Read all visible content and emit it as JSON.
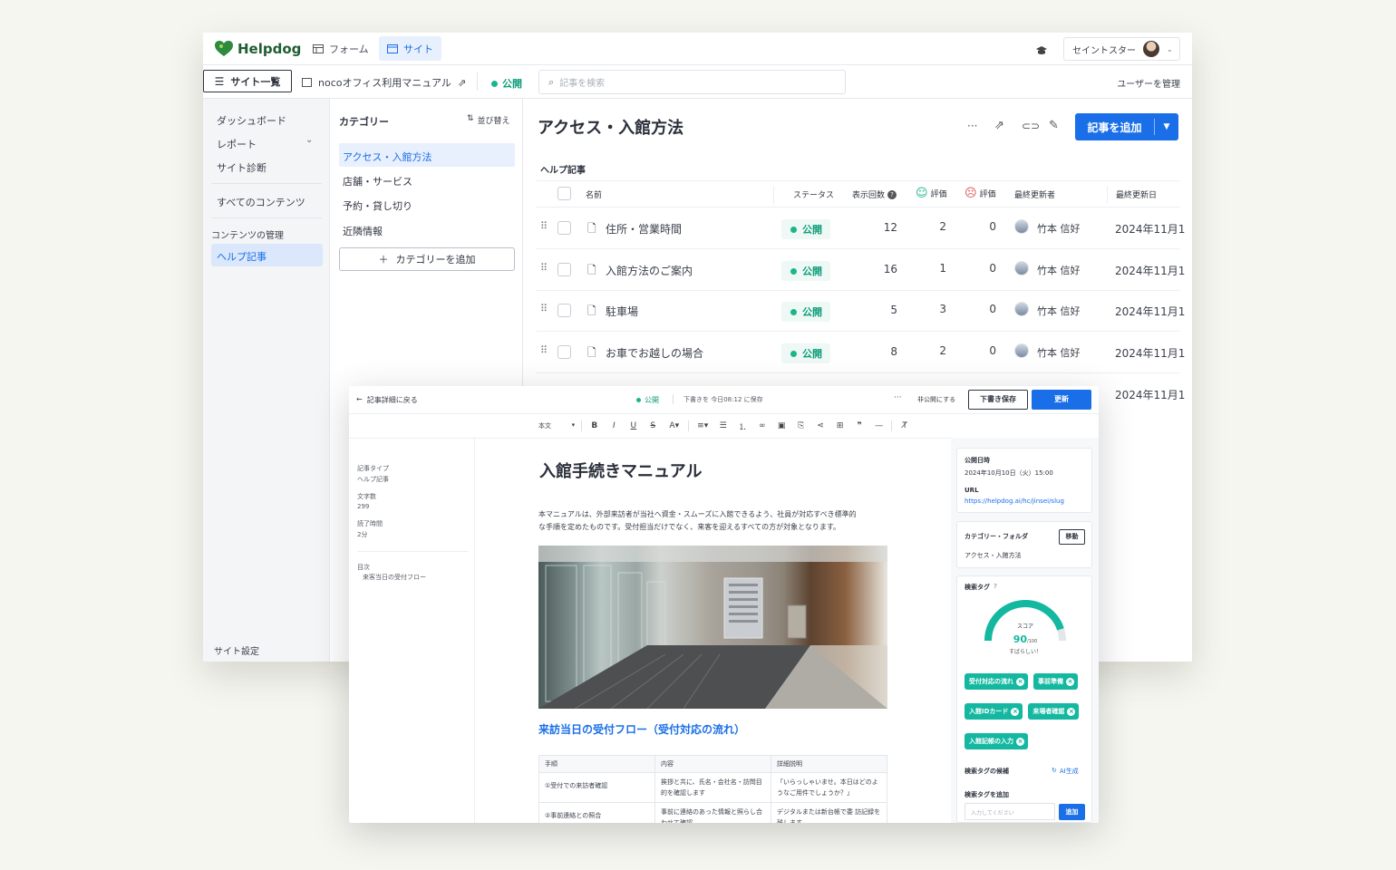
{
  "app": {
    "logo": "Helpdog",
    "nav_tabs": [
      "フォーム",
      "サイト"
    ],
    "account_name": "セイントスター",
    "site_list_label": "サイト一覧",
    "site_name": "nocoオフィス利用マニュアル",
    "site_status": "公開",
    "search_placeholder": "記事を検索",
    "manage_users_label": "ユーザーを管理"
  },
  "left_nav": {
    "items": [
      "ダッシュボード",
      "レポート",
      "サイト診断",
      "すべてのコンテンツ"
    ],
    "section_title": "コンテンツの管理",
    "active_item": "ヘルプ記事",
    "footer": "サイト設定"
  },
  "categories": {
    "title": "カテゴリー",
    "sort_label": "並び替え",
    "items": [
      "アクセス・入館方法",
      "店舗・サービス",
      "予約・貸し切り",
      "近隣情報"
    ],
    "add_label": "カテゴリーを追加"
  },
  "main": {
    "title": "アクセス・入館方法",
    "add_article_label": "記事を追加",
    "section_label": "ヘルプ記事",
    "columns": [
      "名前",
      "ステータス",
      "表示回数",
      "評価",
      "評価",
      "最終更新者",
      "最終更新日"
    ],
    "rows": [
      {
        "name": "住所・営業時間",
        "status": "公開",
        "views": "12",
        "good": "2",
        "bad": "0",
        "updater": "竹本 信好",
        "date": "2024年11月1"
      },
      {
        "name": "入館方法のご案内",
        "status": "公開",
        "views": "16",
        "good": "1",
        "bad": "0",
        "updater": "竹本 信好",
        "date": "2024年11月1"
      },
      {
        "name": "駐車場",
        "status": "公開",
        "views": "5",
        "good": "3",
        "bad": "0",
        "updater": "竹本 信好",
        "date": "2024年11月1"
      },
      {
        "name": "お車でお越しの場合",
        "status": "公開",
        "views": "8",
        "good": "2",
        "bad": "0",
        "updater": "竹本 信好",
        "date": "2024年11月1"
      }
    ],
    "partial_row_date": "2024年11月1"
  },
  "editor": {
    "back_label": "記事詳細に戻る",
    "status": "公開",
    "saved_text": "下書きを 今日08:12 に保存",
    "unpublish_label": "非公開にする",
    "save_draft_label": "下書き保存",
    "update_label": "更新",
    "style_select": "本文",
    "meta": {
      "type_label": "記事タイプ",
      "type_value": "ヘルプ記事",
      "chars_label": "文字数",
      "chars_value": "299",
      "read_label": "読了時間",
      "read_value": "2分",
      "toc_label": "目次",
      "toc_item": "来客当日の受付フロー"
    },
    "doc_title": "入館手続きマニュアル",
    "intro_line1": "本マニュアルは、外部来訪者が当社へ資金・スムーズに入館できるよう、社員が対応すべき標準的",
    "intro_line2": "な手順を定めたものです。受付担当だけでなく、来客を迎えるすべての方が対象となります。",
    "h2": "来訪当日の受付フロー（受付対応の流れ）",
    "table_headers": [
      "手順",
      "内容",
      "詳細説明"
    ],
    "table_rows": [
      [
        "①受付での来訪者確認",
        "挨拶と共に、氏名・会社名・訪問目的を確認します",
        "「いらっしゃいませ。本日はどのようなご用件でしょうか？」"
      ],
      [
        "②事前連絡との照合",
        "事前に連絡のあった情報と照らし合わせて確認",
        "デジタルまたは新台帳で委 訪記録を残します"
      ]
    ],
    "side": {
      "publish_label": "公開日時",
      "publish_value": "2024年10月10日（火）15:00",
      "url_label": "URL",
      "url_value": "https://helpdog.ai/hc/jinsei/slug",
      "category_label": "カテゴリー・フォルダ",
      "move_label": "移動",
      "category_value": "アクセス・入館方法",
      "tags_label": "検索タグ",
      "score_label": "スコア",
      "score_value": "90",
      "score_max": "/100",
      "score_comment": "すばらしい！",
      "tags": [
        "受付対応の流れ",
        "事前準備",
        "入館IDカード",
        "来場者確認",
        "入館記帳の入力"
      ],
      "candidates_label": "検索タグの候補",
      "ai_label": "AI生成",
      "add_tag_label": "検索タグを追加",
      "input_placeholder": "入力してください",
      "add_button": "追加"
    }
  },
  "colors": {
    "primary": "#1a6fe8",
    "teal": "#14b8a0",
    "green_status": "#1bb58c",
    "logo_green": "#1f7a3e"
  }
}
